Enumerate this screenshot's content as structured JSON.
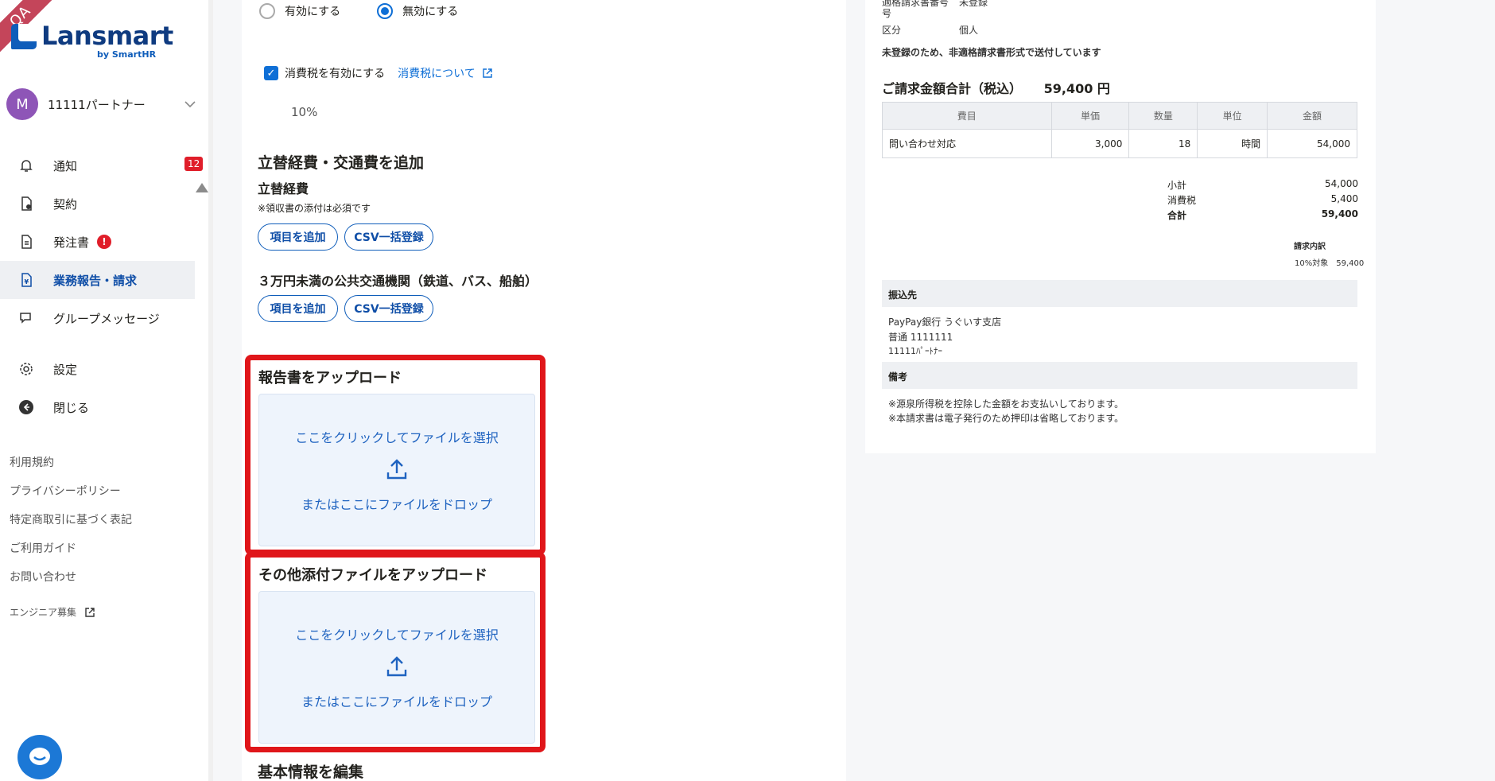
{
  "ribbon": "QA",
  "brand": {
    "name": "Lansmart",
    "sub": "by SmartHR"
  },
  "account": {
    "initial": "M",
    "name": "11111パートナー"
  },
  "nav": {
    "notifications": {
      "label": "通知",
      "count": "12"
    },
    "contracts": {
      "label": "契約"
    },
    "orders": {
      "label": "発注書",
      "alert": "!"
    },
    "reports": {
      "label": "業務報告・請求"
    },
    "group_messages": {
      "label": "グループメッセージ"
    },
    "settings": {
      "label": "設定"
    },
    "close": {
      "label": "閉じる"
    }
  },
  "footer": [
    "利用規約",
    "プライバシーポリシー",
    "特定商取引に基づく表記",
    "ご利用ガイド",
    "お問い合わせ",
    "エンジニア募集"
  ],
  "form": {
    "radio_enable": "有効にする",
    "radio_disable": "無効にする",
    "tax_checkbox": "消費税を有効にする",
    "tax_link": "消費税について",
    "tax_rate": "10%",
    "expenses_title": "立替経費・交通費を追加",
    "expenses_sub": "立替経費",
    "expenses_note": "※領収書の添付は必須です",
    "add_item": "項目を追加",
    "csv_bulk": "CSV一括登録",
    "transport_title": "３万円未満の公共交通機関（鉄道、バス、船舶）",
    "report_upload_title": "報告書をアップロード",
    "other_upload_title": "その他添付ファイルをアップロード",
    "drop_click": "ここをクリックしてファイルを選択",
    "drop_or": "またはここにファイルをドロップ",
    "basic_info": "基本情報を編集"
  },
  "preview": {
    "top_partial_label": "適格請求書番号",
    "top_partial_value": "未登録",
    "top_partial_label2": "号",
    "category_label": "区分",
    "category_value": "個人",
    "notice": "未登録のため、非適格請求書形式で送付しています",
    "total_label": "ご請求金額合計（税込）",
    "total_value": "59,400 円",
    "table_headers": [
      "費目",
      "単価",
      "数量",
      "単位",
      "金額"
    ],
    "table_rows": [
      [
        "問い合わせ対応",
        "3,000",
        "18",
        "時間",
        "54,000"
      ]
    ],
    "subtotal_label": "小計",
    "subtotal": "54,000",
    "tax_label": "消費税",
    "tax": "5,400",
    "sum_label": "合計",
    "sum": "59,400",
    "breakdown_label": "請求内訳",
    "breakdown_value": "10%対象　59,400",
    "bank_title": "振込先",
    "bank_lines": [
      "PayPay銀行 うぐいす支店",
      "普通 1111111",
      "11111ﾊﾟｰﾄﾅｰ"
    ],
    "remarks_title": "備考",
    "remarks_lines": [
      "※源泉所得税を控除した金額をお支払いしております。",
      "※本請求書は電子発行のため押印は省略しております。"
    ]
  }
}
